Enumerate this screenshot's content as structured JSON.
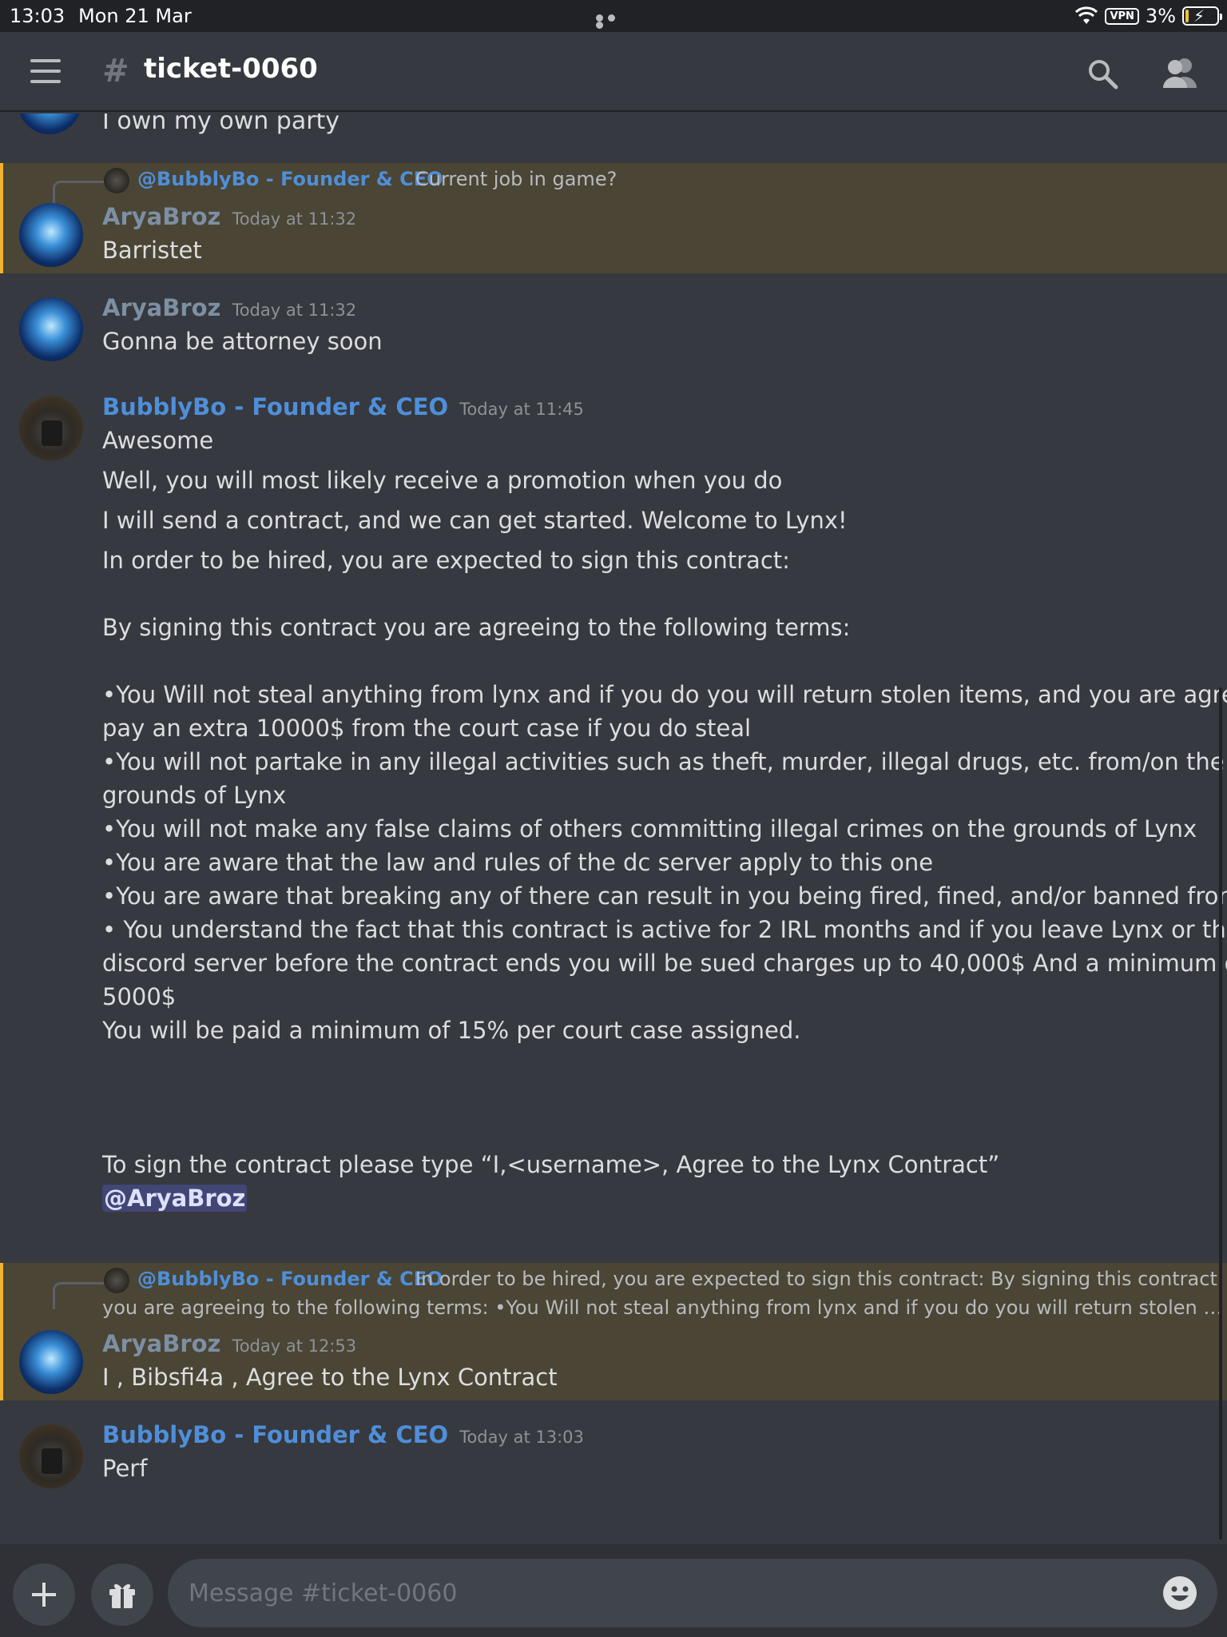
{
  "status_bar": {
    "time": "13:03",
    "date": "Mon 21 Mar",
    "vpn": "VPN",
    "battery": "3%"
  },
  "header": {
    "channel_name": "ticket-0060"
  },
  "messages": {
    "partial_text": "I own my own party",
    "m1": {
      "reply_author": "@BubblyBo - Founder & CEO",
      "reply_text": "Current job in game?",
      "author": "AryaBroz",
      "timestamp": "Today at 11:32",
      "text": "Barristet"
    },
    "m2": {
      "author": "AryaBroz",
      "timestamp": "Today at 11:32",
      "text": "Gonna be attorney soon"
    },
    "m3": {
      "author": "BubblyBo - Founder & CEO",
      "timestamp": "Today at 11:45",
      "lines": [
        "Awesome",
        "Well, you will most likely receive a promotion when you do",
        "I will send a contract, and we can get started. Welcome to Lynx!",
        "In order to be hired, you are expected to sign this contract:",
        "By signing this contract you are agreeing to the following terms:",
        "•You Will not steal anything from lynx and if you do you will return stolen items, and you are agreeing to",
        "pay an extra 10000$ from the court case if you do steal",
        "•You will not partake in any illegal activities such as theft, murder, illegal drugs, etc. from/on the",
        "grounds of Lynx",
        "•You will not make any false claims of others committing illegal crimes on the grounds of Lynx",
        "•You are aware that the law and rules of the dc server apply to this one",
        "•You are aware that breaking any of there can result in you being fired, fined, and/or banned from Lynx",
        "• You understand the fact that this contract is active for 2 IRL months and if you leave Lynx or the",
        "discord server before the contract ends you will be sued charges up to 40,000$ And a minimum of",
        "5000$",
        "You will be paid a minimum of 15% per court case assigned.",
        "To sign the contract please type “I,<username>, Agree to the Lynx Contract”"
      ],
      "mention": "@AryaBroz"
    },
    "m4": {
      "reply_author": "@BubblyBo - Founder & CEO",
      "reply_text_1": "In order to be hired, you are expected to sign this contract:   By signing this contract",
      "reply_text_2": "you are agreeing to the following terms:  •You Will not steal anything from lynx and if you do you will return stolen …",
      "author": "AryaBroz",
      "timestamp": "Today at 12:53",
      "text": "I , Bibsfi4a , Agree to the Lynx Contract"
    },
    "m5": {
      "author": "BubblyBo - Founder & CEO",
      "timestamp": "Today at 13:03",
      "text": "Perf"
    }
  },
  "composer": {
    "placeholder": "Message #ticket-0060"
  },
  "icons": {
    "hamburger": "hamburger-icon",
    "channel": "thread-hash-icon",
    "search": "search-icon",
    "members": "members-icon",
    "plus": "plus-icon",
    "gift": "gift-icon",
    "emoji": "emoji-icon"
  },
  "colors": {
    "background": "#36393f",
    "highlight": "#4a4535",
    "highlight_bar": "#f0b232",
    "role_blue": "#4f8fd9",
    "mention_bg": "#414675"
  }
}
